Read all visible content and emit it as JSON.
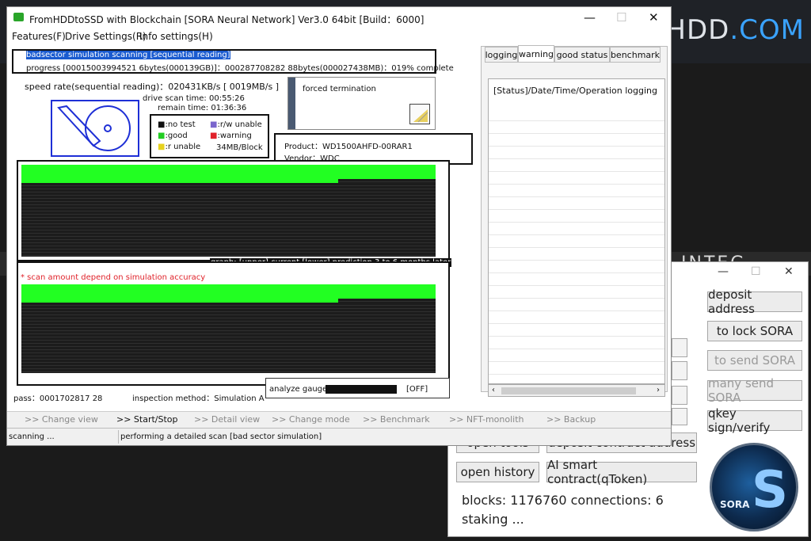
{
  "background": {
    "site_text": "HDD",
    "site_text_dot": ".COM",
    "band_text": "INTEG"
  },
  "main_window": {
    "title": "FromHDDtoSSD with Blockchain [SORA Neural Network] Ver3.0 64bit [Build：6000]",
    "controls": {
      "minimize": "—",
      "maximize": "☐",
      "close": "✕"
    },
    "menu": [
      "Features(F)",
      "Drive Settings(R)",
      "Info settings(H)"
    ],
    "scan_header": "badsector simulation scanning [sequential reading]",
    "progress": "progress [00015003994521 6bytes(000139GB)]：000287708282 88bytes(000027438MB)：019% complete",
    "speed_rate": "speed rate(sequential reading)：020431KB/s [ 0019MB/s ]",
    "drive_scan_time": "drive scan time: 00:55:26",
    "remain_time": "remain time: 01:36:36",
    "forced_termination": "forced termination",
    "legend": [
      {
        "label": ":no test",
        "color": "#111111"
      },
      {
        "label": ":r/w unable",
        "color": "#7a66cc"
      },
      {
        "label": ":good",
        "color": "#22cc22"
      },
      {
        "label": ":warning",
        "color": "#e0222a"
      },
      {
        "label": ":r unable",
        "color": "#e6d11e"
      },
      {
        "label": "34MB/Block",
        "color": ""
      }
    ],
    "product": "Product：WD1500AHFD-00RAR1",
    "vendor": "Vendor：WDC",
    "graph_label": "graph: [upper] current [lower] prediction 3 to 6 months later",
    "scan_note": "* scan amount depend on simulation accuracy",
    "pass": "pass：0001702817 28",
    "inspection_method": "inspection method：Simulation A",
    "analyze_gauge_label": "analyze gauge",
    "analyze_gauge_state": "[OFF]",
    "tabs": [
      "logging",
      "warning",
      "good status",
      "benchmark"
    ],
    "active_tab": "warning",
    "log_header": "[Status]/Date/Time/Operation logging",
    "function_bar": [
      {
        "label": ">> Change view",
        "enabled": false
      },
      {
        "label": ">> Start/Stop",
        "enabled": true
      },
      {
        "label": ">> Detail view",
        "enabled": false
      },
      {
        "label": ">> Change mode",
        "enabled": false
      },
      {
        "label": ">> Benchmark",
        "enabled": false
      },
      {
        "label": ">> NFT-monolith",
        "enabled": false
      },
      {
        "label": ">> Backup",
        "enabled": false
      }
    ],
    "status_left": "scanning ...",
    "status_right": "performing a detailed scan [bad sector simulation]"
  },
  "wallet_window": {
    "controls": {
      "minimize": "—",
      "maximize": "☐",
      "close": "✕"
    },
    "buttons_right": [
      {
        "label": "deposit address",
        "enabled": true
      },
      {
        "label": "to lock SORA",
        "enabled": true
      },
      {
        "label": "to send SORA",
        "enabled": false
      },
      {
        "label": "many send SORA",
        "enabled": false
      },
      {
        "label": "qkey sign/verify",
        "enabled": true
      }
    ],
    "buttons_row1": [
      "open tools",
      "deposit contract address"
    ],
    "buttons_row2": [
      "open history",
      "AI smart contract(qToken)"
    ],
    "blocks_line": "blocks: 1176760 connections: 6",
    "staking_line": "staking ...",
    "logo_text": "SORA"
  }
}
